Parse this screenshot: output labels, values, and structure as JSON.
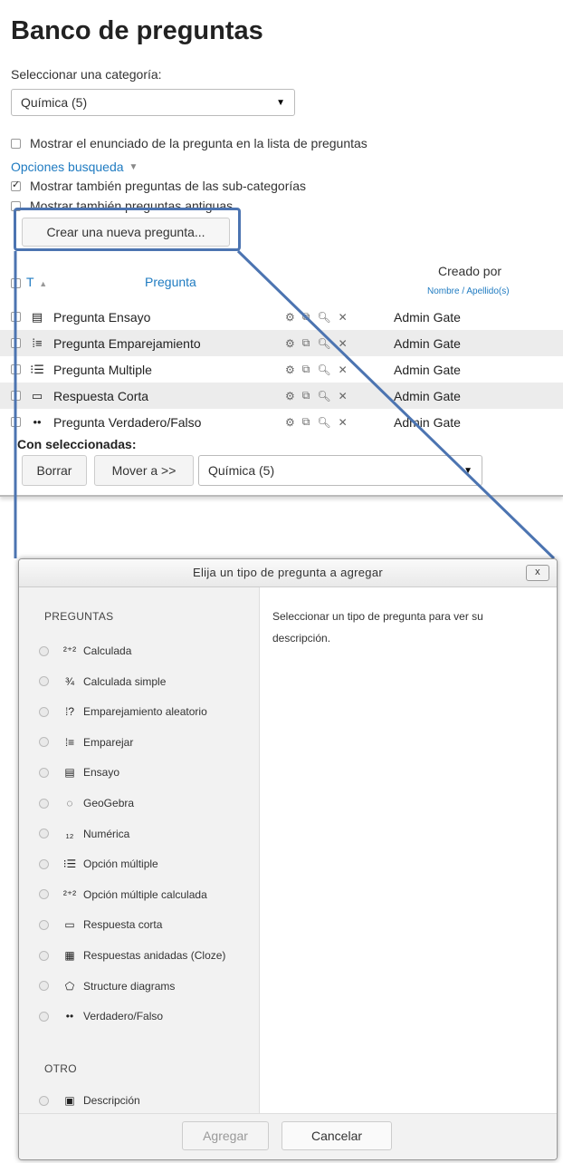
{
  "page": {
    "title": "Banco de preguntas",
    "category_label": "Seleccionar una categoría:",
    "category_value": "Química (5)",
    "show_statement_label": "Mostrar el enunciado de la pregunta en la lista de preguntas",
    "search_options_label": "Opciones busqueda",
    "show_subcat_label": "Mostrar también preguntas de las sub-categorías",
    "show_old_label": "Mostrar también preguntas antiguas",
    "create_button": "Crear una nueva pregunta..."
  },
  "table": {
    "col_type": "T",
    "col_question": "Pregunta",
    "col_created": "Creado por",
    "col_created_sub": "Nombre / Apellido(s)",
    "rows": [
      {
        "icon": "essay-icon",
        "name": "Pregunta Ensayo",
        "creator": "Admin Gate"
      },
      {
        "icon": "matching-icon",
        "name": "Pregunta Emparejamiento",
        "creator": "Admin Gate"
      },
      {
        "icon": "multichoice-icon",
        "name": "Pregunta Multiple",
        "creator": "Admin Gate"
      },
      {
        "icon": "shortanswer-icon",
        "name": "Respuesta Corta",
        "creator": "Admin Gate"
      },
      {
        "icon": "truefalse-icon",
        "name": "Pregunta Verdadero/Falso",
        "creator": "Admin Gate"
      }
    ],
    "with_selected": "Con seleccionadas:",
    "delete_button": "Borrar",
    "move_button": "Mover a >>",
    "move_target": "Química (5)"
  },
  "dialog": {
    "title": "Elija un tipo de pregunta a agregar",
    "close_label": "x",
    "section_questions": "PREGUNTAS",
    "options": [
      {
        "icon": "calculated-icon",
        "label": "Calculada"
      },
      {
        "icon": "calculated-simple-icon",
        "label": "Calculada simple"
      },
      {
        "icon": "random-matching-icon",
        "label": "Emparejamiento aleatorio"
      },
      {
        "icon": "matching-icon",
        "label": "Emparejar"
      },
      {
        "icon": "essay-icon",
        "label": "Ensayo"
      },
      {
        "icon": "geogebra-icon",
        "label": "GeoGebra"
      },
      {
        "icon": "numerical-icon",
        "label": "Numérica"
      },
      {
        "icon": "multichoice-icon",
        "label": "Opción múltiple"
      },
      {
        "icon": "calculated-multichoice-icon",
        "label": "Opción múltiple calculada"
      },
      {
        "icon": "shortanswer-icon",
        "label": "Respuesta corta"
      },
      {
        "icon": "cloze-icon",
        "label": "Respuestas anidadas (Cloze)"
      },
      {
        "icon": "structure-diagram-icon",
        "label": "Structure diagrams"
      },
      {
        "icon": "truefalse-icon",
        "label": "Verdadero/Falso"
      }
    ],
    "section_other": "OTRO",
    "other_options": [
      {
        "icon": "description-icon",
        "label": "Descripción"
      }
    ],
    "description": "Seleccionar un tipo de pregunta para ver su descripción.",
    "add_button": "Agregar",
    "cancel_button": "Cancelar"
  },
  "colors": {
    "link": "#1f7bc1",
    "highlight_callout": "#4c74b1",
    "row_alt": "#ececec"
  }
}
